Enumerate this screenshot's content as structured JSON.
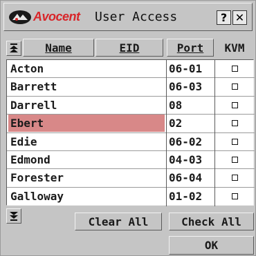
{
  "title": {
    "brand": "Avocent",
    "text": "User Access",
    "help_label": "?",
    "close_label": "✕"
  },
  "columns": {
    "name": "Name",
    "eid": "EID",
    "port": "Port",
    "kvm": "KVM"
  },
  "rows": [
    {
      "name": "Acton",
      "port": "06-01",
      "kvm": false,
      "selected": false
    },
    {
      "name": "Barrett",
      "port": "06-03",
      "kvm": false,
      "selected": false
    },
    {
      "name": "Darrell",
      "port": "08",
      "kvm": false,
      "selected": false
    },
    {
      "name": "Ebert",
      "port": "02",
      "kvm": false,
      "selected": true
    },
    {
      "name": "Edie",
      "port": "06-02",
      "kvm": false,
      "selected": false
    },
    {
      "name": "Edmond",
      "port": "04-03",
      "kvm": false,
      "selected": false
    },
    {
      "name": "Forester",
      "port": "06-04",
      "kvm": false,
      "selected": false
    },
    {
      "name": "Galloway",
      "port": "01-02",
      "kvm": false,
      "selected": false
    }
  ],
  "buttons": {
    "clear_all": "Clear All",
    "check_all": "Check All",
    "ok": "OK"
  },
  "colors": {
    "brand": "#d8262a",
    "highlight": "#d88888",
    "window": "#c5c5c5"
  },
  "icons": {
    "logo": "avocent-logo-icon",
    "scroll_up": "scroll-up-icon",
    "scroll_down": "scroll-down-icon"
  }
}
